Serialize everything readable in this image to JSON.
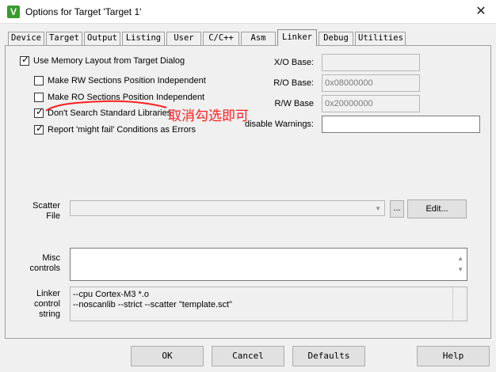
{
  "window": {
    "title": "Options for Target 'Target 1'",
    "app_icon_glyph": "V"
  },
  "tabs": [
    {
      "label": "Device"
    },
    {
      "label": "Target"
    },
    {
      "label": "Output"
    },
    {
      "label": "Listing"
    },
    {
      "label": "User"
    },
    {
      "label": "C/C++"
    },
    {
      "label": "Asm"
    },
    {
      "label": "Linker",
      "active": true
    },
    {
      "label": "Debug"
    },
    {
      "label": "Utilities"
    }
  ],
  "linker": {
    "use_memory_layout": {
      "label": "Use Memory Layout from Target Dialog",
      "checked": true
    },
    "rw_independent": {
      "label": "Make RW Sections Position Independent",
      "checked": false
    },
    "ro_independent": {
      "label": "Make RO Sections Position Independent",
      "checked": false
    },
    "dont_search_std": {
      "label": "Don't Search Standard Libraries",
      "checked": true
    },
    "report_might_fail": {
      "label": "Report 'might fail' Conditions as Errors",
      "checked": true
    },
    "xo_base": {
      "label": "X/O Base:",
      "value": ""
    },
    "ro_base": {
      "label": "R/O Base:",
      "value": "0x08000000"
    },
    "rw_base": {
      "label": "R/W Base",
      "value": "0x20000000"
    },
    "disable_warnings": {
      "label": "disable Warnings:",
      "value": ""
    },
    "scatter_file": {
      "label_line1": "Scatter",
      "label_line2": "File",
      "value": "",
      "browse_label": "...",
      "edit_label": "Edit..."
    },
    "misc_controls": {
      "label_line1": "Misc",
      "label_line2": "controls",
      "value": ""
    },
    "linker_control_string": {
      "label_line1": "Linker",
      "label_line2": "control",
      "label_line3": "string",
      "line1": "--cpu Cortex-M3 *.o",
      "line2": "--noscanlib --strict --scatter \"template.sct\""
    }
  },
  "annotation": {
    "text": "取消勾选即可",
    "color": "#ff2020"
  },
  "buttons": {
    "ok": "OK",
    "cancel": "Cancel",
    "defaults": "Defaults",
    "help": "Help"
  },
  "icons": {
    "close": "close-icon",
    "checkmark": "checkmark-icon",
    "dropdown": "chevron-down-icon",
    "scroll_up": "scroll-up-icon",
    "scroll_down": "scroll-down-icon"
  },
  "glyphs": {
    "close": "✕",
    "check": "✓",
    "chevron": "▼",
    "up": "▲",
    "down": "▼"
  }
}
